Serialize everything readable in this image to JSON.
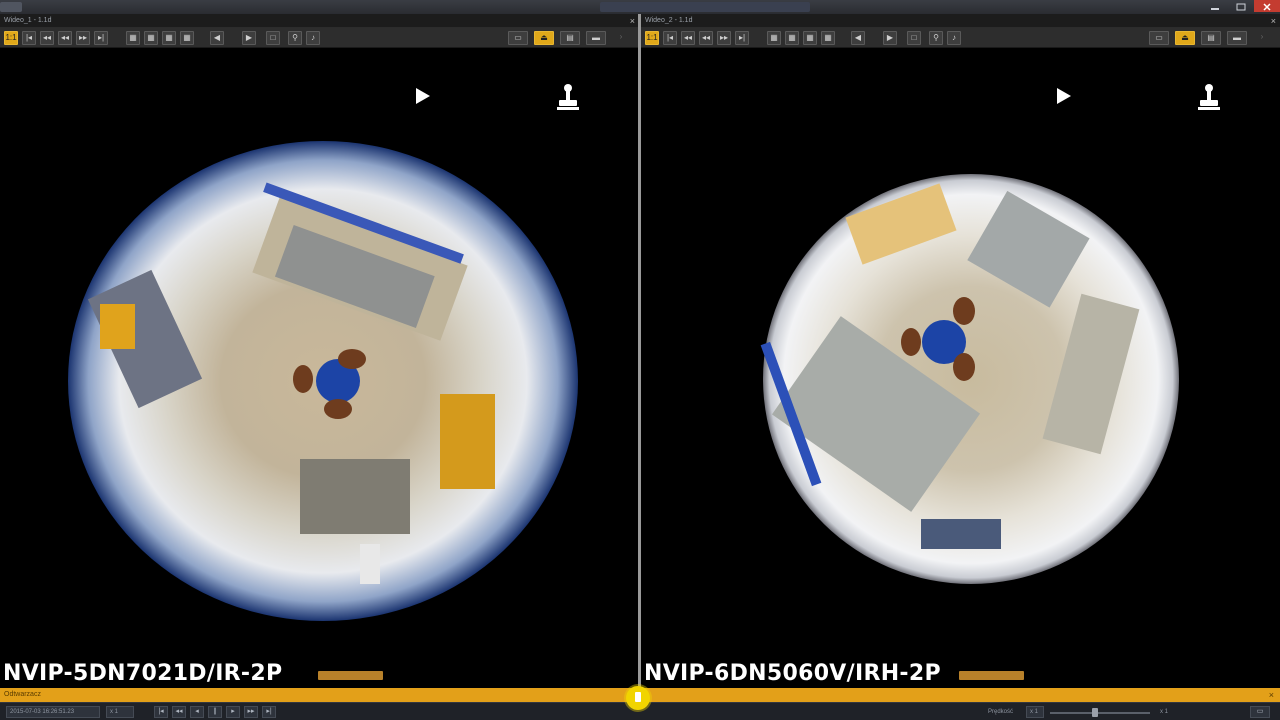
{
  "window": {
    "title": "",
    "controls": [
      "minimize-icon",
      "maximize-icon",
      "close-icon"
    ]
  },
  "panes": [
    {
      "title": "Wideo_1 - 1.1d",
      "camera_label": "NVIP-5DN7021D/IR-2P",
      "close_label": "×",
      "toolbar_icons": [
        "layout-1x1-icon",
        "step-back-icon",
        "step-back-icon",
        "rewind-icon",
        "fast-forward-icon",
        "step-forward-icon",
        "grid-icon",
        "grid-icon",
        "grid-icon",
        "grid-icon",
        "audio-left-icon",
        "audio-right-icon",
        "snapshot-icon",
        "tool-icon",
        "speaker-icon",
        "fullscreen-icon",
        "joystick-icon",
        "panel-icon",
        "toggle-icon"
      ]
    },
    {
      "title": "Wideo_2 - 1.1d",
      "camera_label": "NVIP-6DN5060V/IRH-2P",
      "close_label": "×",
      "toolbar_icons": [
        "layout-1x1-icon",
        "step-back-icon",
        "step-back-icon",
        "rewind-icon",
        "fast-forward-icon",
        "step-forward-icon",
        "grid-icon",
        "grid-icon",
        "grid-icon",
        "grid-icon",
        "audio-left-icon",
        "audio-right-icon",
        "snapshot-icon",
        "tool-icon",
        "speaker-icon",
        "fullscreen-icon",
        "joystick-icon",
        "panel-icon",
        "toggle-icon"
      ]
    }
  ],
  "status": {
    "label": "Odtwarzacz",
    "close_label": "×"
  },
  "playback": {
    "datetime": "2015-07-03 16:26:51.23",
    "speed_box": "x 1",
    "speed_label": "Prędkość",
    "speed_value": "x 1",
    "speed_min": "x 1",
    "speed_level": 0.45
  },
  "colors": {
    "accent": "#e3a019",
    "orange_bar": "#b8812a",
    "timeline_thumb": "#f1d400"
  }
}
